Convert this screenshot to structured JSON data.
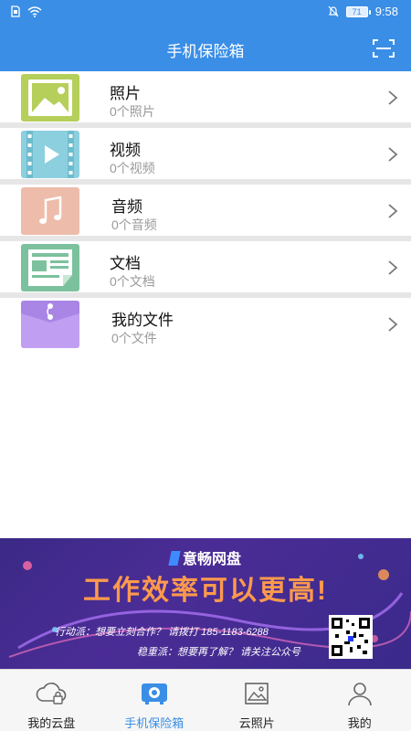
{
  "status_bar": {
    "time": "9:58",
    "battery": "71"
  },
  "header": {
    "title": "手机保险箱"
  },
  "items": [
    {
      "name": "照片",
      "count": "0个照片",
      "color": "#b5cf5a"
    },
    {
      "name": "视频",
      "count": "0个视频",
      "color": "#8ccfdf"
    },
    {
      "name": "音频",
      "count": "0个音频",
      "color": "#eebcaa"
    },
    {
      "name": "文档",
      "count": "0个文档",
      "color": "#7cc19d"
    },
    {
      "name": "我的文件",
      "count": "0个文件",
      "color": "#c09ff2"
    }
  ],
  "ad": {
    "brand": "意畅网盘",
    "headline": "工作效率可以更高!",
    "contact_line1": "行动派：想要立刻合作？ 请拨打 185-1183-6288",
    "contact_line2": "稳重派：想要再了解？ 请关注公众号"
  },
  "tabs": [
    {
      "label": "我的云盘",
      "icon": "cloud-lock-icon",
      "active": false
    },
    {
      "label": "手机保险箱",
      "icon": "safe-box-icon",
      "active": true
    },
    {
      "label": "云照片",
      "icon": "photo-icon",
      "active": false
    },
    {
      "label": "我的",
      "icon": "person-icon",
      "active": false
    }
  ],
  "colors": {
    "primary": "#3a8ee6",
    "divider": "#e6e6e6",
    "muted_text": "#9a9a9a"
  }
}
